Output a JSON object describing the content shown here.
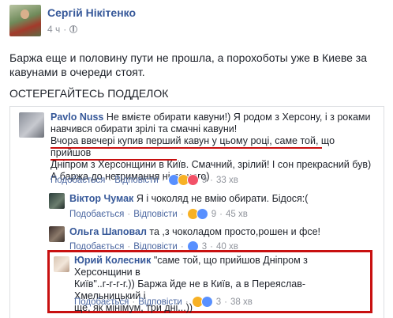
{
  "post": {
    "author": "Сергій Нікітенко",
    "time": "4 ч",
    "text": "Баржа еще и половину пути не прошла, а порохоботы уже в Киеве за кавунами в очереди стоят.",
    "warning": "ОСТЕРЕГАЙТЕСЬ ПОДДЕЛОК"
  },
  "comments": [
    {
      "name": "Pavlo Nuss",
      "lines": [
        "Не вмієте обирати кавуни!) Я родом з Херсону, і з роками",
        "навчився обирати зрілі та смачні кавуни!",
        "Вчора ввечері купив перший кавун у цьому році, саме той, що прийшов",
        "Дніпром з Херсонщини в Київ. Смачний, зрілий! І сон прекрасний був)",
        "А баржа до нетримання ні до чого)"
      ],
      "like": "Подобається",
      "reply": "Відповісти",
      "count": "9",
      "time": "33 хв"
    },
    {
      "name": "Віктор Чумак",
      "text": "Я і чоколяд не вмію обирати. Бідося:(",
      "like": "Подобається",
      "reply": "Відповісти",
      "count": "9",
      "time": "45 хв"
    },
    {
      "name": "Ольга Шаповал",
      "text": "та ,з чоколадом просто,рошен и фсе!",
      "like": "Подобається",
      "reply": "Відповісти",
      "count": "3",
      "time": "40 хв"
    },
    {
      "name": "Юрий Колесник",
      "lines": [
        "\"саме той, що прийшов Дніпром з Херсонщини в",
        "Київ\"..г-г-г-г.)) Баржа йде не в Київ, а в Переяслав-Хмельницький і",
        "ще, як мінімум, три дні...))"
      ],
      "like": "Подобається",
      "reply": "Відповісти",
      "count": "3",
      "time": "38 хв"
    }
  ],
  "colors": {
    "link": "#365899",
    "highlight": "#c81010",
    "muted": "#90949c"
  }
}
